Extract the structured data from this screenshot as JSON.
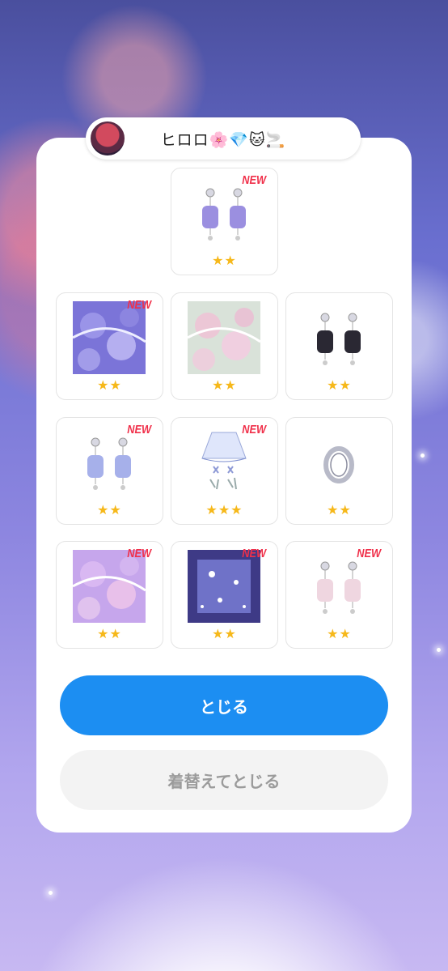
{
  "user": {
    "name": "ヒロロ🌸💎🐱🚬"
  },
  "items": [
    {
      "stars": "★★",
      "new": "NEW",
      "icon": "hydrangea-earrings-purple-icon"
    },
    {
      "stars": "★★",
      "new": "NEW",
      "icon": "hydrangea-background-blue-icon"
    },
    {
      "stars": "★★",
      "new": "",
      "icon": "hydrangea-background-pink-icon"
    },
    {
      "stars": "★★",
      "new": "",
      "icon": "hydrangea-earrings-black-icon"
    },
    {
      "stars": "★★",
      "new": "NEW",
      "icon": "hydrangea-earrings-blue-icon"
    },
    {
      "stars": "★★★",
      "new": "NEW",
      "icon": "skirt-and-shoes-icon"
    },
    {
      "stars": "★★",
      "new": "",
      "icon": "hoop-earring-icon"
    },
    {
      "stars": "★★",
      "new": "NEW",
      "icon": "hydrangea-background-lavender-icon"
    },
    {
      "stars": "★★",
      "new": "NEW",
      "icon": "snow-floor-icon"
    },
    {
      "stars": "★★",
      "new": "NEW",
      "icon": "hydrangea-earrings-pink-icon"
    }
  ],
  "buttons": {
    "close": "とじる",
    "change_and_close": "着替えてとじる"
  },
  "colors": {
    "primary": "#1c8ef2",
    "star": "#f6b81a",
    "new_badge": "#f0304a"
  }
}
